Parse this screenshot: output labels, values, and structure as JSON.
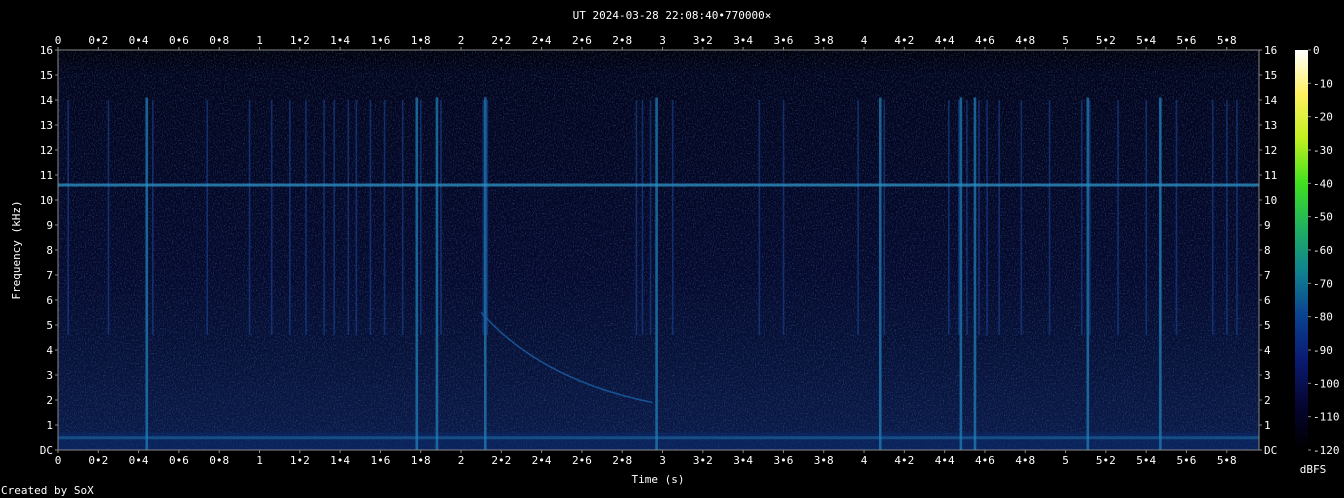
{
  "chart_data": {
    "type": "heatmap",
    "title": "UT 2024-03-28 22:08:40•770000×",
    "xlabel": "Time (s)",
    "ylabel": "Frequency (kHz)",
    "credit": "Created by SoX",
    "colorbar_label": "dBFS",
    "xlim": [
      0,
      5.96
    ],
    "ylim": [
      0,
      16
    ],
    "x_ticks": [
      "0",
      "0•2",
      "0•4",
      "0•6",
      "0•8",
      "1",
      "1•2",
      "1•4",
      "1•6",
      "1•8",
      "2",
      "2•2",
      "2•4",
      "2•6",
      "2•8",
      "3",
      "3•2",
      "3•4",
      "3•6",
      "3•8",
      "4",
      "4•2",
      "4•4",
      "4•6",
      "4•8",
      "5",
      "5•2",
      "5•4",
      "5•6",
      "5•8"
    ],
    "x_tick_values": [
      0,
      0.2,
      0.4,
      0.6,
      0.8,
      1,
      1.2,
      1.4,
      1.6,
      1.8,
      2,
      2.2,
      2.4,
      2.6,
      2.8,
      3,
      3.2,
      3.4,
      3.6,
      3.8,
      4,
      4.2,
      4.4,
      4.6,
      4.8,
      5,
      5.2,
      5.4,
      5.6,
      5.8
    ],
    "y_ticks": [
      "DC",
      "1",
      "2",
      "3",
      "4",
      "5",
      "6",
      "7",
      "8",
      "9",
      "10",
      "11",
      "12",
      "13",
      "14",
      "15",
      "16"
    ],
    "colorbar_ticks": [
      "0",
      "-10",
      "-20",
      "-30",
      "-40",
      "-50",
      "-60",
      "-70",
      "-80",
      "-90",
      "-100",
      "-110",
      "-120"
    ],
    "colorbar_range": [
      -120,
      0
    ],
    "colormap": [
      "#000000",
      "#050530",
      "#0a1a70",
      "#0a4090",
      "#108090",
      "#20b060",
      "#40e020",
      "#c0f020",
      "#fff060",
      "#ffffff"
    ],
    "features": {
      "horizontal_line_khz": 10.6,
      "low_band_khz": [
        0,
        0.7
      ],
      "whistler_descent": {
        "start_s": 2.1,
        "start_khz": 5.5,
        "end_s": 2.95,
        "end_khz": 1.9
      },
      "strong_impulses_s": [
        0.44,
        1.78,
        1.88,
        2.12,
        2.97,
        4.08,
        4.48,
        4.55,
        5.11,
        5.47
      ],
      "impulses_s": [
        0.05,
        0.25,
        0.47,
        0.74,
        0.95,
        1.06,
        1.15,
        1.23,
        1.32,
        1.37,
        1.44,
        1.48,
        1.55,
        1.62,
        1.71,
        1.8,
        1.9,
        2.11,
        2.13,
        2.87,
        2.9,
        2.94,
        3.05,
        3.48,
        3.6,
        3.97,
        4.1,
        4.42,
        4.47,
        4.51,
        4.57,
        4.61,
        4.67,
        4.78,
        4.92,
        5.08,
        5.12,
        5.26,
        5.4,
        5.47,
        5.55,
        5.73,
        5.8,
        5.85
      ]
    }
  }
}
